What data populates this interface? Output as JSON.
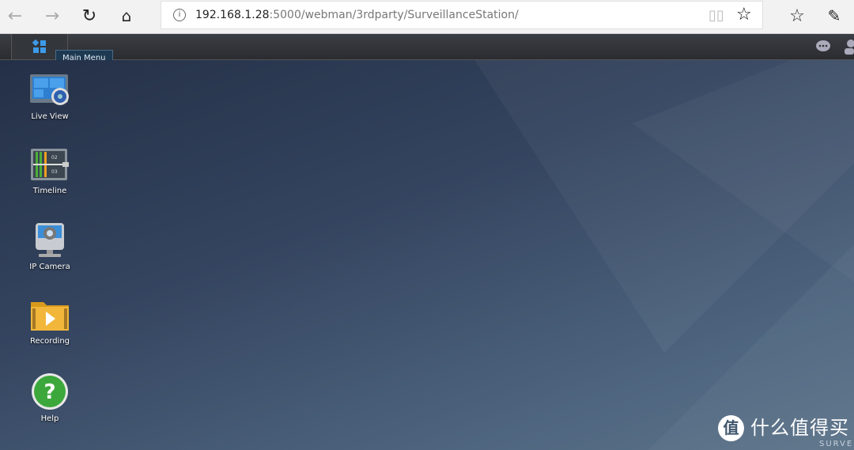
{
  "browser": {
    "url_host": "192.168.1.28",
    "url_rest": ":5000/webman/3rdparty/SurveillanceStation/",
    "icons": [
      "back-icon",
      "forward-icon",
      "refresh-icon",
      "home-icon",
      "info-icon",
      "reading-view-icon",
      "favorite-star-icon",
      "favorites-list-icon",
      "pen-icon"
    ]
  },
  "taskbar": {
    "main_menu_tooltip": "Main Menu",
    "icons": [
      "main-menu-icon",
      "chat-icon",
      "user-icon"
    ]
  },
  "desktop": {
    "items": [
      {
        "label": "Live View",
        "icon": "live-view-icon"
      },
      {
        "label": "Timeline",
        "icon": "timeline-icon",
        "icon_text": [
          "02",
          "03"
        ]
      },
      {
        "label": "IP Camera",
        "icon": "ip-camera-icon"
      },
      {
        "label": "Recording",
        "icon": "recording-folder-icon"
      },
      {
        "label": "Help",
        "icon": "help-icon"
      }
    ]
  },
  "watermark": {
    "badge": "值",
    "text": "什么值得买",
    "corner": "SURVE"
  }
}
